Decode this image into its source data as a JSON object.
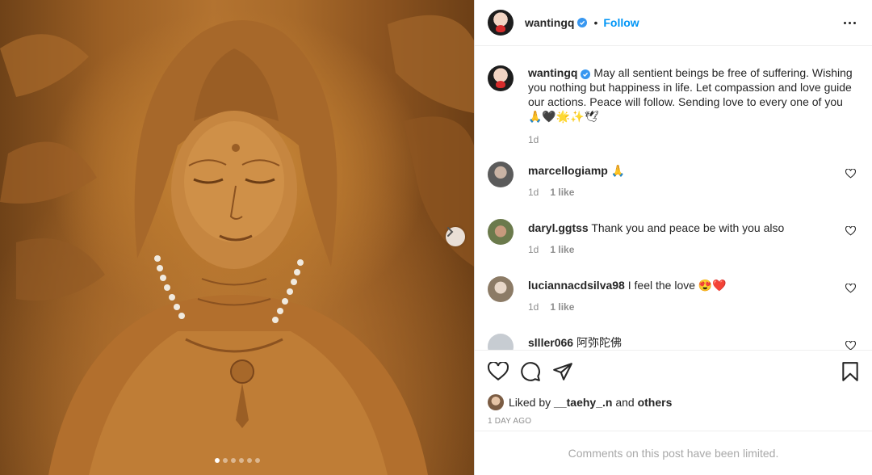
{
  "post": {
    "author": "wantingq",
    "follow_label": "Follow",
    "separator": "•"
  },
  "media": {
    "carousel_count": 6,
    "carousel_active": 1
  },
  "caption": {
    "username": "wantingq",
    "text": "May all sentient beings be free of suffering. Wishing you nothing but happiness in life. Let compassion and love guide our actions. Peace will follow. Sending love to every one of you 🙏🖤🌟✨🕊",
    "time": "1d"
  },
  "comments": [
    {
      "username": "marcellogiamp",
      "text": "🙏",
      "time": "1d",
      "likes": "1 like"
    },
    {
      "username": "daryl.ggtss",
      "text": "Thank you and peace be with you also",
      "time": "1d",
      "likes": "1 like"
    },
    {
      "username": "luciannacdsilva98",
      "text": "I feel the love 😍❤️",
      "time": "1d",
      "likes": "1 like"
    },
    {
      "username": "slller066",
      "text": "阿弥陀佛",
      "time": "",
      "likes": ""
    }
  ],
  "likes": {
    "prefix": "Liked by",
    "user": "__taehy_.n",
    "joiner": "and",
    "others": "others"
  },
  "date_label": "1 DAY AGO",
  "limited_notice": "Comments on this post have been limited.",
  "colors": {
    "follow": "#0095f6",
    "verified": "#3897f0",
    "muted": "#8e8e8e",
    "border": "#dbdbdb"
  },
  "icons": [
    "verified-badge-icon",
    "more-options-icon",
    "like-heart-icon",
    "comment-icon",
    "share-icon",
    "bookmark-icon",
    "next-arrow-icon"
  ]
}
